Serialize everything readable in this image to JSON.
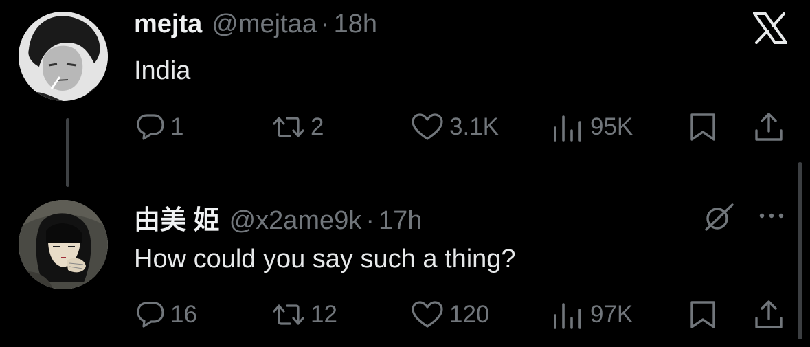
{
  "posts": [
    {
      "name": "mejta",
      "handle": "@mejtaa",
      "separator": "·",
      "time": "18h",
      "text": "India",
      "replies": "1",
      "reposts": "2",
      "likes": "3.1K",
      "views": "95K"
    },
    {
      "name": "由美 姫",
      "handle": "@x2ame9k",
      "separator": "·",
      "time": "17h",
      "text": "How could you say such a thing?",
      "replies": "16",
      "reposts": "12",
      "likes": "120",
      "views": "97K"
    }
  ],
  "icons": {
    "brand": "x-logo-icon",
    "grok": "slashed-circle-icon",
    "more": "more-options-icon",
    "reply": "reply-icon",
    "repost": "repost-icon",
    "like": "heart-icon",
    "views": "views-icon",
    "bookmark": "bookmark-icon",
    "share": "share-icon"
  },
  "colors": {
    "background": "#000000",
    "primary_text": "#e7e9ea",
    "secondary_text": "#71767b"
  }
}
